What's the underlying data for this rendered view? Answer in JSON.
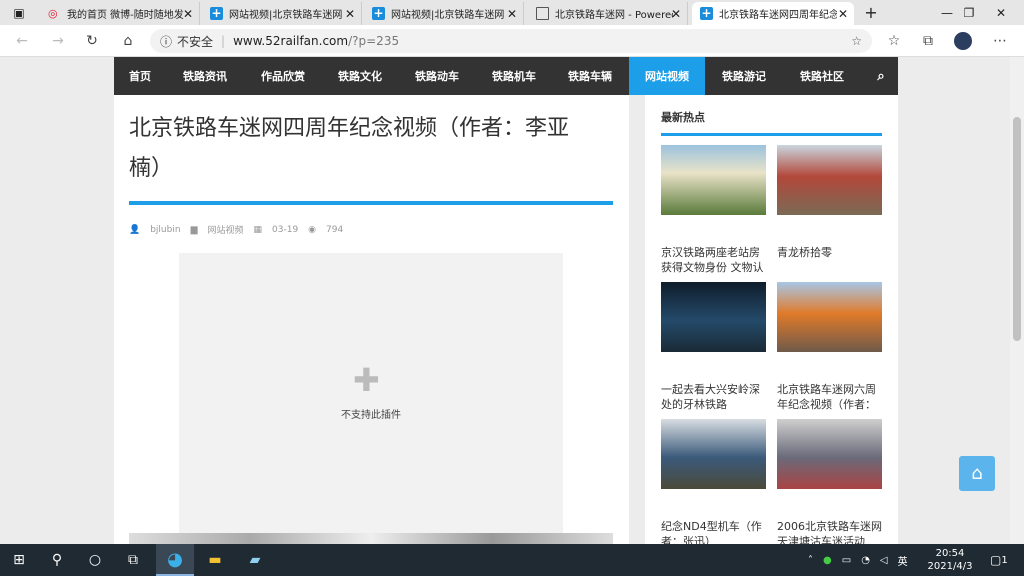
{
  "tabs": [
    {
      "title": "我的首页 微博-随时随地发"
    },
    {
      "title": "网站视频|北京铁路车迷网"
    },
    {
      "title": "网站视频|北京铁路车迷网"
    },
    {
      "title": "北京铁路车迷网 - Powered"
    },
    {
      "title": "北京铁路车迷网四周年纪念"
    }
  ],
  "address": {
    "insecure_label": "不安全",
    "host": "www.52railfan.com",
    "path": "/?p=235"
  },
  "nav": [
    "首页",
    "铁路资讯",
    "作品欣赏",
    "铁路文化",
    "铁路动车",
    "铁路机车",
    "铁路车辆",
    "网站视频",
    "铁路游记",
    "铁路社区"
  ],
  "post": {
    "title": "北京铁路车迷网四周年纪念视频（作者：李亚楠）",
    "author": "bjlubin",
    "category": "网站视频",
    "date": "03-19",
    "views": "794",
    "plugin_text": "不支持此插件"
  },
  "sidebar": {
    "heading": "最新热点",
    "items": [
      {
        "caption": "京汉铁路两座老站房获得文物身份 文物认"
      },
      {
        "caption": "青龙桥拾零"
      },
      {
        "caption": "一起去看大兴安岭深处的牙林铁路"
      },
      {
        "caption": "北京铁路车迷网六周年纪念视频（作者："
      },
      {
        "caption": "纪念ND4型机车（作者：张迅）"
      },
      {
        "caption": "2006北京铁路车迷网天津塘沽车迷活动"
      }
    ]
  },
  "taskbar": {
    "ime": "英",
    "time": "20:54",
    "date": "2021/4/3",
    "notif": "1"
  },
  "colors": {
    "accent": "#1c9ee8",
    "nav_bg": "#333333",
    "taskbar": "#1f2a33"
  }
}
